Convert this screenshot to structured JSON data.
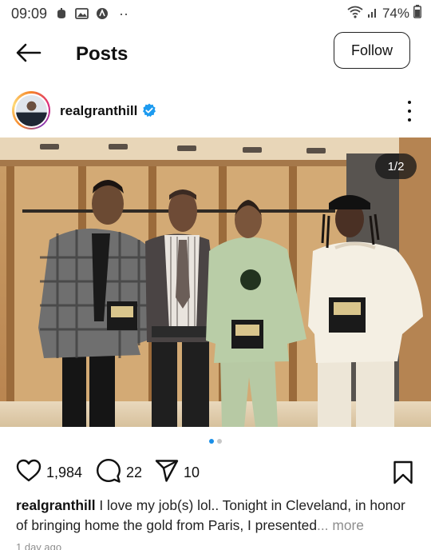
{
  "status_bar": {
    "time": "09:09",
    "battery": "74%",
    "left_icons": [
      "notification-icon",
      "gallery-icon",
      "app-icon"
    ],
    "overflow": "··"
  },
  "header": {
    "title": "Posts",
    "follow_label": "Follow"
  },
  "post": {
    "username": "realgranthill",
    "verified": true,
    "page_indicator": "1/2",
    "carousel": {
      "current": 1,
      "total": 2
    },
    "likes": "1,984",
    "comments": "22",
    "shares": "10",
    "caption_user": "realgranthill",
    "caption_text": " I love my job(s) lol.. Tonight in Cleveland, in honor of bringing home the gold from Paris, I presented",
    "caption_more": "... more",
    "time_ago": "1 day ago"
  },
  "colors": {
    "accent_blue": "#1a8fe8",
    "verified_blue": "#1d9bf0",
    "muted_text": "#8e8e8e"
  }
}
